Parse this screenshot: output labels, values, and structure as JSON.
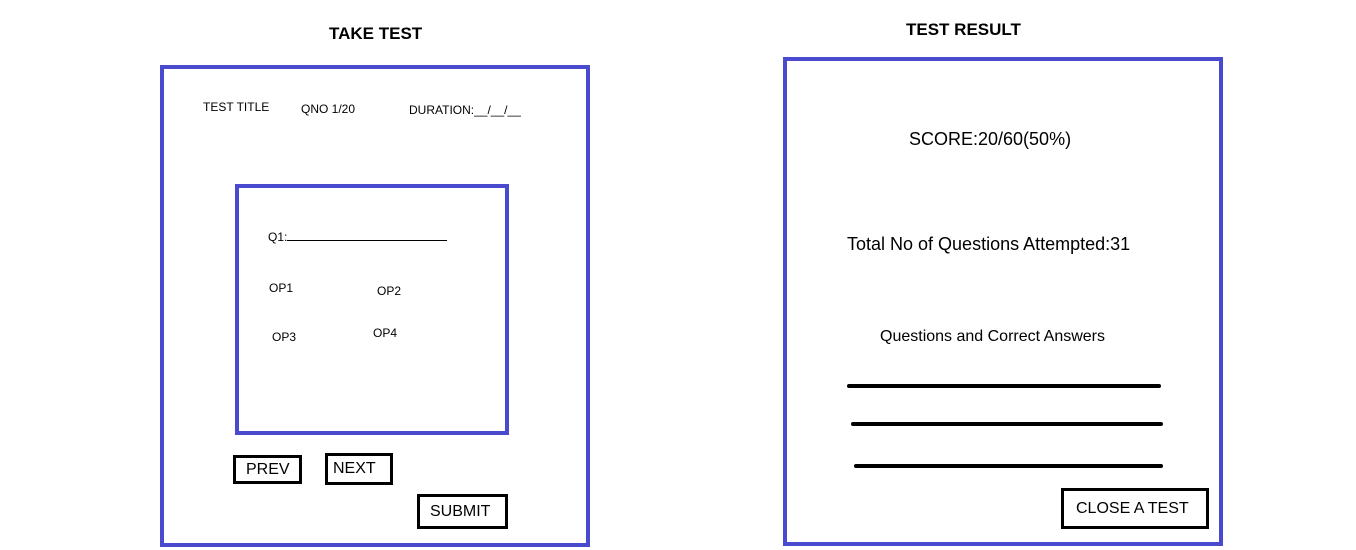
{
  "take_test": {
    "heading": "TAKE TEST",
    "test_title": "TEST TITLE",
    "qno": "QNO 1/20",
    "duration": "DURATION:__/__/__",
    "question_label": "Q1:",
    "options": [
      "OP1",
      "OP2",
      "OP3",
      "OP4"
    ],
    "prev_label": "PREV",
    "next_label": "NEXT",
    "submit_label": "SUBMIT"
  },
  "test_result": {
    "heading": "TEST RESULT",
    "score": "SCORE:20/60(50%)",
    "attempted": "Total No of Questions Attempted:31",
    "answers_heading": "Questions and Correct Answers",
    "close_label": "CLOSE A TEST"
  },
  "colors": {
    "frame": "#4a4acf",
    "text": "#000000",
    "background": "#ffffff"
  }
}
